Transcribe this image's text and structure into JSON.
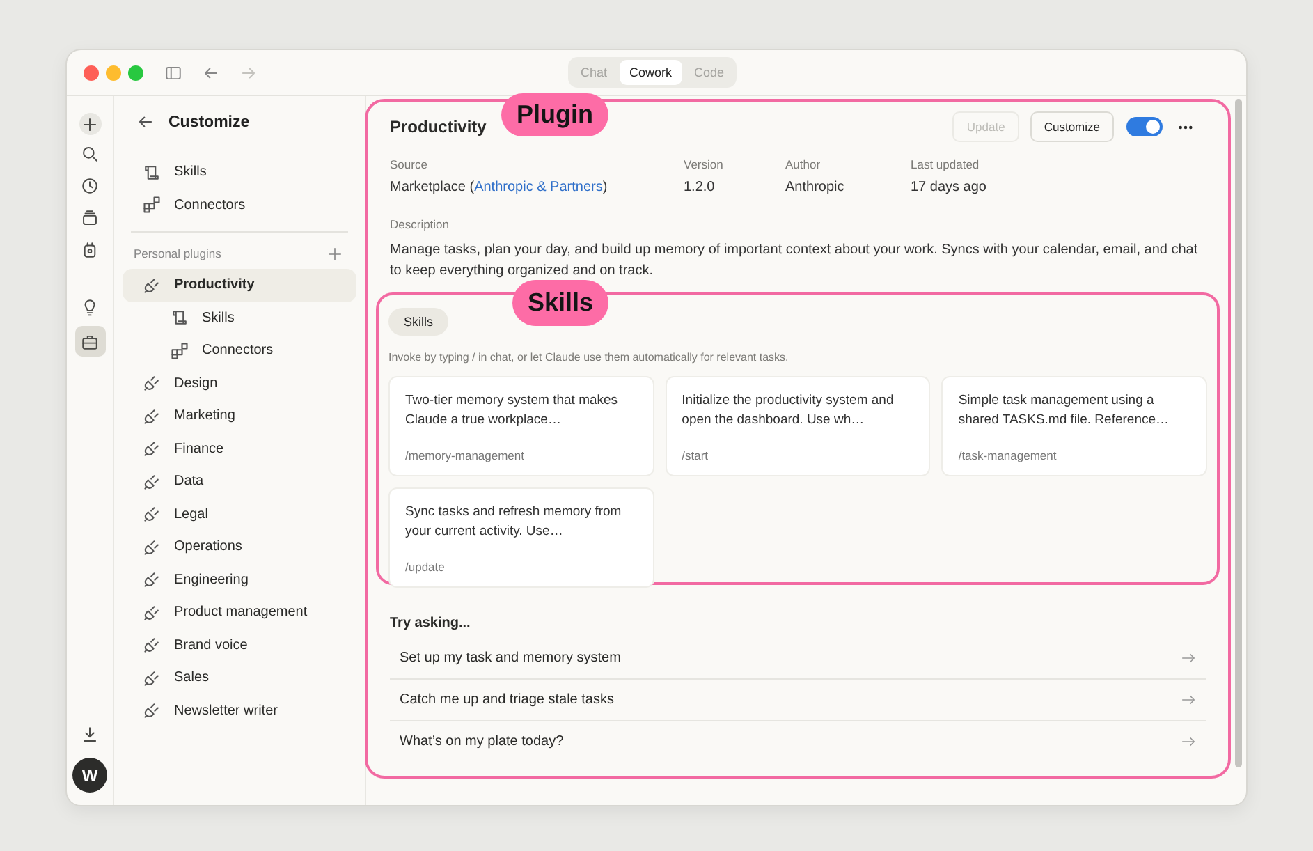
{
  "window": {
    "tabs": [
      {
        "label": "Chat",
        "selected": false
      },
      {
        "label": "Cowork",
        "selected": true
      },
      {
        "label": "Code",
        "selected": false
      }
    ]
  },
  "rail": {
    "items": [
      {
        "kind": "new",
        "selected": false
      },
      {
        "kind": "search",
        "selected": false
      },
      {
        "kind": "history",
        "selected": false
      },
      {
        "kind": "stack",
        "selected": false
      },
      {
        "kind": "robot",
        "selected": false
      },
      {
        "kind": "idea",
        "selected": false
      },
      {
        "kind": "briefcase",
        "selected": true
      }
    ],
    "avatar": "W"
  },
  "sidebar": {
    "title": "Customize",
    "links": [
      {
        "label": "Skills",
        "kind": "skills"
      },
      {
        "label": "Connectors",
        "kind": "connectors"
      }
    ],
    "section": "Personal plugins",
    "plugins": [
      {
        "label": "Productivity",
        "selected": true,
        "children": [
          {
            "label": "Skills",
            "kind": "skills"
          },
          {
            "label": "Connectors",
            "kind": "connectors"
          }
        ]
      },
      {
        "label": "Design",
        "selected": false
      },
      {
        "label": "Marketing",
        "selected": false
      },
      {
        "label": "Finance",
        "selected": false
      },
      {
        "label": "Data",
        "selected": false
      },
      {
        "label": "Legal",
        "selected": false
      },
      {
        "label": "Operations",
        "selected": false
      },
      {
        "label": "Engineering",
        "selected": false
      },
      {
        "label": "Product management",
        "selected": false
      },
      {
        "label": "Brand voice",
        "selected": false
      },
      {
        "label": "Sales",
        "selected": false
      },
      {
        "label": "Newsletter writer",
        "selected": false
      }
    ]
  },
  "plugin": {
    "annotation": "Plugin",
    "title": "Productivity",
    "buttons": [
      {
        "label": "Update",
        "disabled": true
      },
      {
        "label": "Customize",
        "disabled": false
      }
    ],
    "toggle": {
      "on": true
    },
    "meta": [
      {
        "label": "Source",
        "value": "Marketplace (",
        "link": "Anthropic & Partners",
        "suffix": ")"
      },
      {
        "label": "Version",
        "value": "1.2.0"
      },
      {
        "label": "Author",
        "value": "Anthropic"
      },
      {
        "label": "Last updated",
        "value": "17 days ago"
      }
    ],
    "description": {
      "label": "Description",
      "text": "Manage tasks, plan your day, and build up memory of important context about your work. Syncs with your calendar, email, and chat to keep everything organized and on track."
    },
    "skills": {
      "annotation": "Skills",
      "tab": "Skills",
      "hint": "Invoke by typing / in chat, or let Claude use them automatically for relevant tasks.",
      "cards": [
        {
          "description": "Two-tier memory system that makes Claude a true workplace…",
          "command": "/memory-management"
        },
        {
          "description": "Initialize the productivity system and open the dashboard. Use wh…",
          "command": "/start"
        },
        {
          "description": "Simple task management using a shared TASKS.md file. Reference…",
          "command": "/task-management"
        },
        {
          "description": "Sync tasks and refresh memory from your current activity. Use…",
          "command": "/update"
        }
      ]
    },
    "try_asking": {
      "title": "Try asking...",
      "prompts": [
        "Set up my task and memory system",
        "Catch me up and triage stale tasks",
        "What’s on my plate today?"
      ]
    }
  }
}
